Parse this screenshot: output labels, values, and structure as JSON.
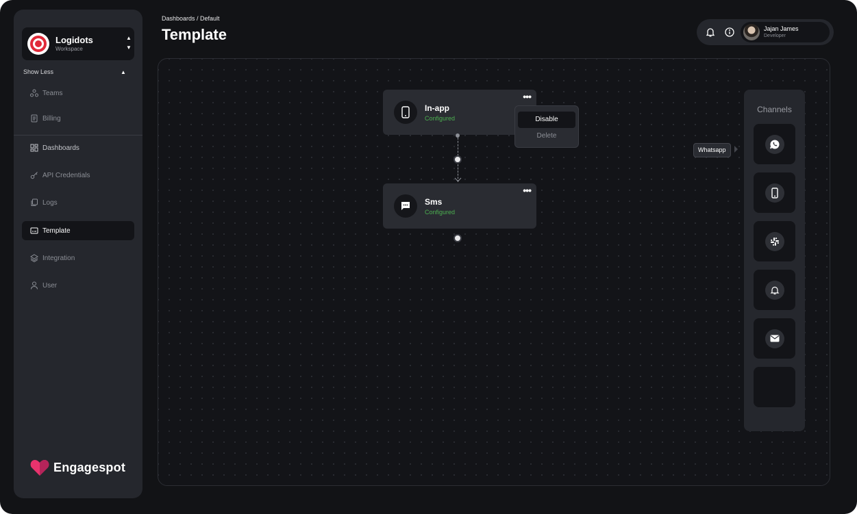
{
  "workspace": {
    "name": "Logidots",
    "subtitle": "Workspace"
  },
  "sidebar": {
    "show_less": "Show Less",
    "items": [
      {
        "label": "Teams",
        "icon": "teams-icon"
      },
      {
        "label": "Billing",
        "icon": "billing-icon"
      },
      {
        "label": "Dashboards",
        "icon": "dashboards-icon"
      },
      {
        "label": "API Credentials",
        "icon": "key-icon"
      },
      {
        "label": "Logs",
        "icon": "logs-icon"
      },
      {
        "label": "Template",
        "icon": "template-icon"
      },
      {
        "label": "Integration",
        "icon": "layers-icon"
      },
      {
        "label": "User",
        "icon": "user-icon"
      }
    ],
    "brand": "Engagespot"
  },
  "header": {
    "breadcrumb": "Dashboards / Default",
    "title": "Template",
    "user": {
      "name": "Jajan James",
      "role": "Developer"
    }
  },
  "workflow": {
    "nodes": [
      {
        "title": "In-app",
        "status": "Configured",
        "icon": "phone-icon"
      },
      {
        "title": "Sms",
        "status": "Configured",
        "icon": "chat-icon"
      }
    ],
    "context_menu": {
      "disable": "Disable",
      "delete": "Delete"
    }
  },
  "channels": {
    "title": "Channels",
    "tooltip": "Whatsapp",
    "items": [
      "whatsapp-icon",
      "phone-icon",
      "slack-icon",
      "bell-icon",
      "mail-icon",
      "empty"
    ]
  },
  "colors": {
    "accent_green": "#4caf50",
    "brand_pink": "#e8336d",
    "background": "#121316"
  }
}
